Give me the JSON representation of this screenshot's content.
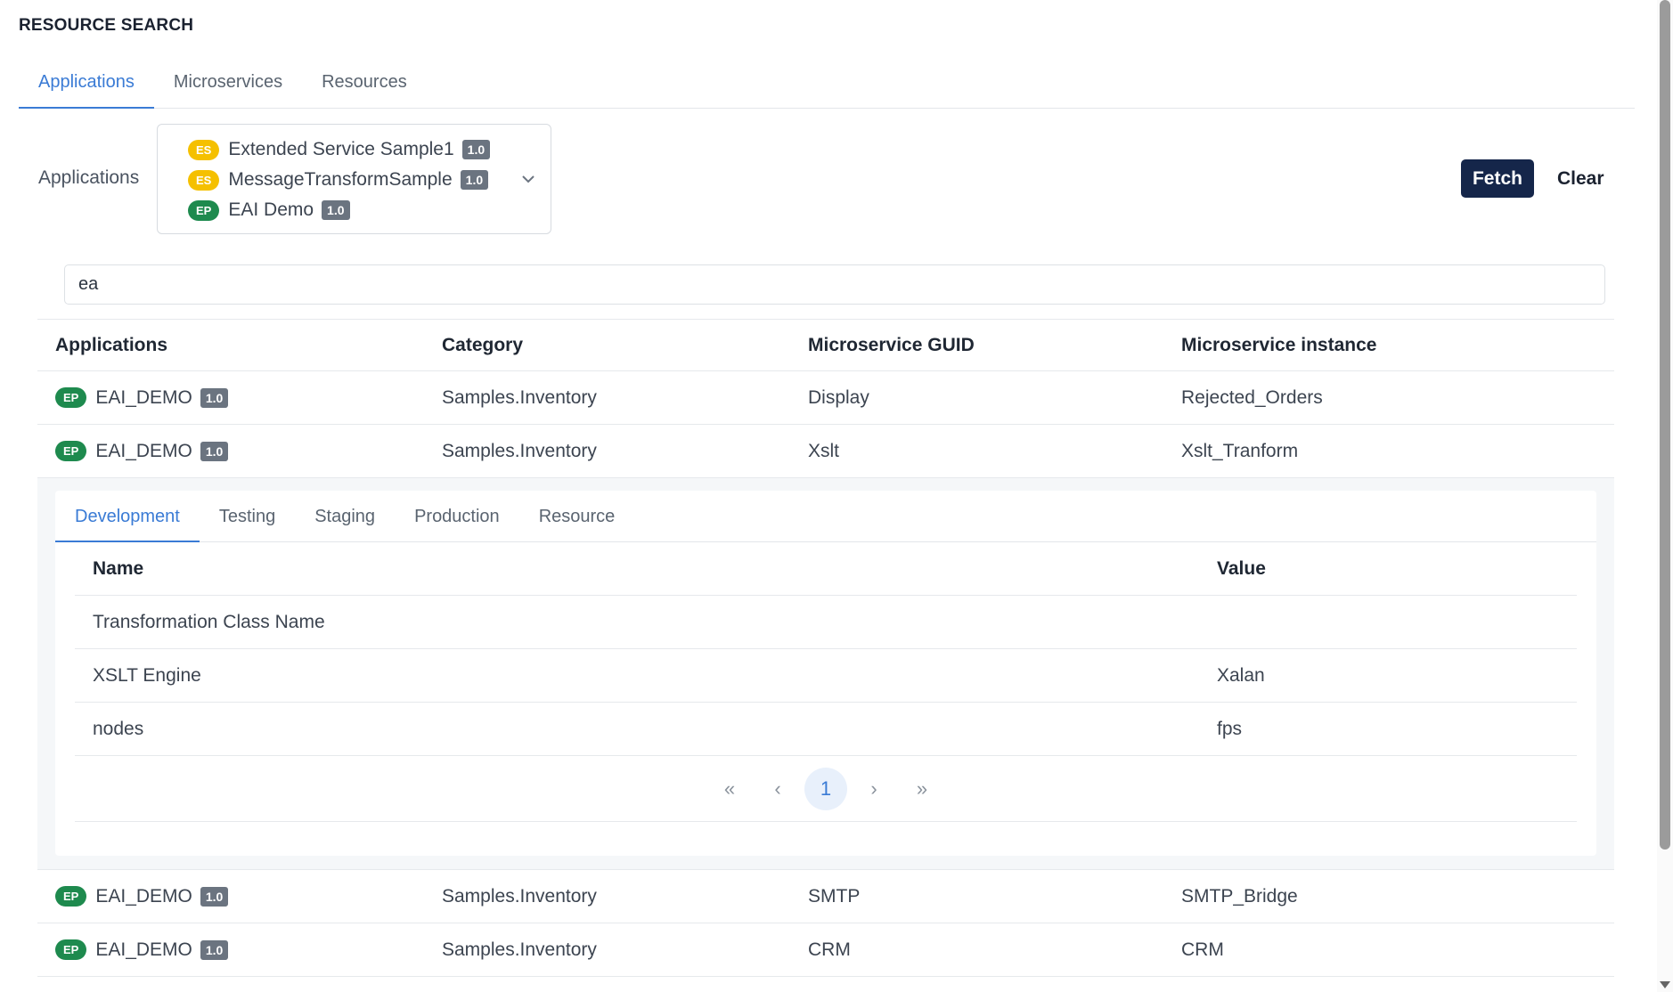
{
  "page_title": "RESOURCE SEARCH",
  "top_tabs": [
    {
      "label": "Applications",
      "active": true
    },
    {
      "label": "Microservices",
      "active": false
    },
    {
      "label": "Resources",
      "active": false
    }
  ],
  "filter": {
    "label": "Applications",
    "selected": [
      {
        "badge": "ES",
        "name": "Extended Service Sample1",
        "version": "1.0"
      },
      {
        "badge": "ES",
        "name": "MessageTransformSample",
        "version": "1.0"
      },
      {
        "badge": "EP",
        "name": "EAI Demo",
        "version": "1.0"
      }
    ],
    "chevron_icon": "chevron-down-icon"
  },
  "actions": {
    "fetch_label": "Fetch",
    "clear_label": "Clear"
  },
  "search": {
    "value": "ea"
  },
  "results": {
    "headers": [
      "Applications",
      "Category",
      "Microservice GUID",
      "Microservice instance"
    ],
    "rows": [
      {
        "badge": "EP",
        "app": "EAI_DEMO",
        "version": "1.0",
        "category": "Samples.Inventory",
        "guid": "Display",
        "instance": "Rejected_Orders"
      },
      {
        "badge": "EP",
        "app": "EAI_DEMO",
        "version": "1.0",
        "category": "Samples.Inventory",
        "guid": "Xslt",
        "instance": "Xslt_Tranform"
      },
      {
        "badge": "EP",
        "app": "EAI_DEMO",
        "version": "1.0",
        "category": "Samples.Inventory",
        "guid": "SMTP",
        "instance": "SMTP_Bridge"
      },
      {
        "badge": "EP",
        "app": "EAI_DEMO",
        "version": "1.0",
        "category": "Samples.Inventory",
        "guid": "CRM",
        "instance": "CRM"
      }
    ]
  },
  "detail": {
    "tabs": [
      {
        "label": "Development",
        "active": true
      },
      {
        "label": "Testing",
        "active": false
      },
      {
        "label": "Staging",
        "active": false
      },
      {
        "label": "Production",
        "active": false
      },
      {
        "label": "Resource",
        "active": false
      }
    ],
    "headers": {
      "name": "Name",
      "value": "Value"
    },
    "rows": [
      {
        "name": "Transformation Class Name",
        "value": ""
      },
      {
        "name": "XSLT Engine",
        "value": "Xalan"
      },
      {
        "name": "nodes",
        "value": "fps"
      }
    ],
    "pagination": {
      "first": "«",
      "prev": "‹",
      "current": "1",
      "next": "›",
      "last": "»"
    }
  },
  "colors": {
    "accent": "#3a7bd5",
    "primary_button": "#15264a",
    "badge_es": "#f5c000",
    "badge_ep": "#1e8a4e",
    "version_badge": "#6b7480"
  }
}
